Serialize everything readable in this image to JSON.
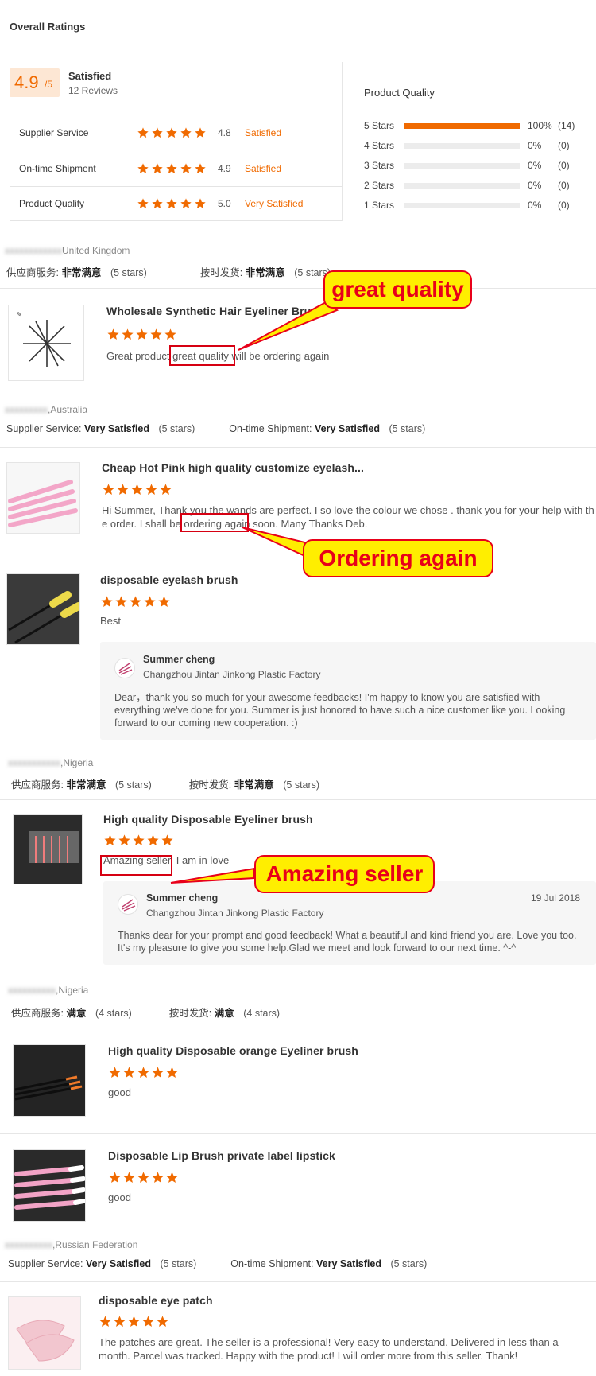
{
  "header": {
    "title": "Overall Ratings"
  },
  "overall": {
    "score": "4.9",
    "score_max": "/5",
    "label": "Satisfied",
    "reviews": "12 Reviews"
  },
  "criteria": [
    {
      "label": "Supplier Service",
      "value": "4.8",
      "rating_label": "Satisfied"
    },
    {
      "label": "On-time Shipment",
      "value": "4.9",
      "rating_label": "Satisfied"
    },
    {
      "label": "Product Quality",
      "value": "5.0",
      "rating_label": "Very Satisfied"
    }
  ],
  "quality_breakdown": {
    "title": "Product Quality",
    "rows": [
      {
        "label": "5 Stars",
        "percent": "100%",
        "count": "(14)",
        "fill": 1.0
      },
      {
        "label": "4 Stars",
        "percent": "0%",
        "count": "(0)",
        "fill": 0
      },
      {
        "label": "3 Stars",
        "percent": "0%",
        "count": "(0)",
        "fill": 0
      },
      {
        "label": "2 Stars",
        "percent": "0%",
        "count": "(0)",
        "fill": 0
      },
      {
        "label": "1 Stars",
        "percent": "0%",
        "count": "(0)",
        "fill": 0
      }
    ]
  },
  "colors": {
    "accent": "#f06a00",
    "callout_bg": "#ffee00",
    "callout_border": "#e8001a"
  },
  "reviews": {
    "r1": {
      "buyer_name": "xxxxxxxxxxxx",
      "country": "United Kingdom",
      "svc_label": "供应商服务:",
      "svc_value": "非常满意",
      "svc_stars": "(5 stars)",
      "ship_label": "按时发货:",
      "ship_value": "非常满意",
      "ship_stars": "(5 stars)",
      "product": "Wholesale Synthetic Hair Eyeliner Brush",
      "text_before": "Great product ",
      "text_highlight": "great quality",
      "text_after": " will be ordering again"
    },
    "r2": {
      "buyer_name": "xxxxxxxxx",
      "country": ",Australia",
      "svc_label": "Supplier Service:",
      "svc_value": "Very Satisfied",
      "svc_stars": "(5 stars)",
      "ship_label": "On-time Shipment:",
      "ship_value": "Very Satisfied",
      "ship_stars": "(5 stars)",
      "product_a": "Cheap Hot Pink high quality customize eyelash...",
      "text_a1": "Hi Summer, Thank you the wands are perfect. I so love the colour we chose . thank you for your help with th",
      "text_a2_before": "e order. I shall be ",
      "text_a2_highlight": "ordering again",
      "text_a2_after": " soon. Many Thanks Deb.",
      "product_b": "disposable eyelash brush",
      "text_b": "Best",
      "reply_name": "Summer cheng",
      "reply_company": "Changzhou Jintan Jinkong Plastic Factory",
      "reply_text": "Dear，thank you so much for your awesome feedbacks! I'm happy to know you are satisfied with everything we've done for you. Summer is just honored to have such a nice customer like you. Looking forward to our coming new cooperation. :)"
    },
    "r3": {
      "buyer_name": "xxxxxxxxxxx",
      "country": ",Nigeria",
      "svc_label": "供应商服务:",
      "svc_value": "非常满意",
      "svc_stars": "(5 stars)",
      "ship_label": "按时发货:",
      "ship_value": "非常满意",
      "ship_stars": "(5 stars)",
      "product": "High quality Disposable Eyeliner brush",
      "text_highlight": "Amazing seller.",
      "text_after": " I am in love",
      "reply_name": "Summer cheng",
      "reply_company": "Changzhou Jintan Jinkong Plastic Factory",
      "reply_date": "19 Jul 2018",
      "reply_text": "Thanks dear for your prompt and good feedback! What a beautiful and kind friend you are. Love you too. It's my pleasure to give you some help.Glad we meet and look forward to our next time. ^-^"
    },
    "r4": {
      "buyer_name": "xxxxxxxxxx",
      "country": ",Nigeria",
      "svc_label": "供应商服务:",
      "svc_value": "满意",
      "svc_stars": "(4 stars)",
      "ship_label": "按时发货:",
      "ship_value": "满意",
      "ship_stars": "(4 stars)",
      "product_a": "High quality Disposable orange Eyeliner brush",
      "text_a": "good",
      "product_b": "Disposable Lip Brush private label lipstick",
      "text_b": "good"
    },
    "r5": {
      "buyer_name": "xxxxxxxxxx",
      "country": ",Russian Federation",
      "svc_label": "Supplier Service:",
      "svc_value": "Very Satisfied",
      "svc_stars": "(5 stars)",
      "ship_label": "On-time Shipment:",
      "ship_value": "Very Satisfied",
      "ship_stars": "(5 stars)",
      "product": "disposable eye patch",
      "text": "The patches are great. The seller is a professional! Very easy to understand. Delivered in less than a month. Parcel was tracked. Happy with the product! I will order more from this seller. Thank!"
    }
  },
  "callouts": {
    "c1": "great quality",
    "c2": "Ordering again",
    "c3": "Amazing seller"
  }
}
